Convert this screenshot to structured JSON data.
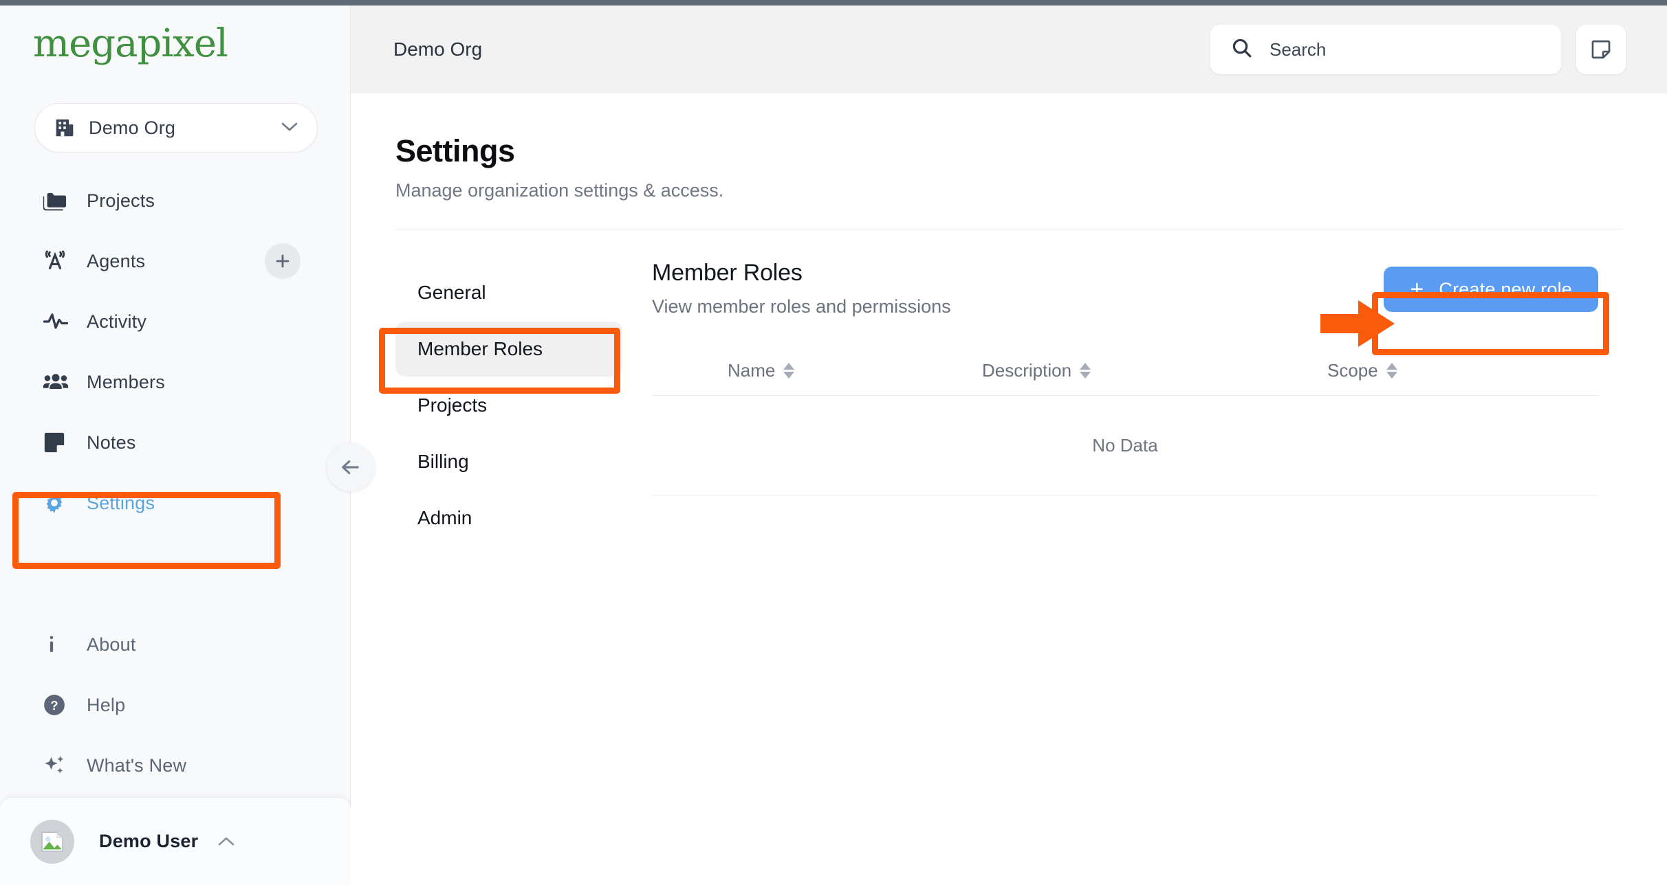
{
  "brand": {
    "logo_text": "megapixel",
    "logo_color": "#3f9140"
  },
  "sidebar": {
    "org_switcher": {
      "name": "Demo Org",
      "icon": "building-icon",
      "caret": "chevron-down-icon"
    },
    "items": [
      {
        "label": "Projects",
        "icon": "folder-icon",
        "active": false
      },
      {
        "label": "Agents",
        "icon": "broadcast-tower-icon",
        "active": false,
        "action": "add-agent-button"
      },
      {
        "label": "Activity",
        "icon": "pulse-icon",
        "active": false
      },
      {
        "label": "Members",
        "icon": "people-icon",
        "active": false
      },
      {
        "label": "Notes",
        "icon": "note-icon",
        "active": false
      },
      {
        "label": "Settings",
        "icon": "gear-icon",
        "active": true
      }
    ],
    "secondary_items": [
      {
        "label": "About",
        "icon": "info-icon"
      },
      {
        "label": "Help",
        "icon": "question-circle-icon"
      },
      {
        "label": "What's New",
        "icon": "sparkles-icon"
      }
    ],
    "user": {
      "name": "Demo User",
      "avatar": "broken-image-avatar",
      "caret": "chevron-up-icon"
    },
    "collapse": {
      "icon": "arrow-left-icon"
    },
    "active_color": "#59a5e0"
  },
  "topbar": {
    "title": "Demo Org",
    "search": {
      "placeholder": "Search",
      "icon": "search-icon"
    },
    "note_button": {
      "icon": "sticky-note-icon"
    }
  },
  "page": {
    "title": "Settings",
    "subtitle": "Manage organization settings & access."
  },
  "settings_tabs": [
    {
      "label": "General",
      "active": false
    },
    {
      "label": "Member Roles",
      "active": true
    },
    {
      "label": "Projects",
      "active": false
    },
    {
      "label": "Billing",
      "active": false
    },
    {
      "label": "Admin",
      "active": false
    }
  ],
  "panel": {
    "title": "Member Roles",
    "subtitle": "View member roles and permissions",
    "create_button": {
      "label": "Create new role",
      "icon": "plus-icon",
      "color": "#5b9cf3"
    },
    "table": {
      "columns": [
        {
          "label": "Name",
          "sortable": true
        },
        {
          "label": "Description",
          "sortable": true
        },
        {
          "label": "Scope",
          "sortable": true
        }
      ],
      "rows": [],
      "empty_text": "No Data"
    }
  },
  "annotations": {
    "color": "#fa5a09",
    "boxes": [
      {
        "target": "sidebar-item-settings"
      },
      {
        "target": "settings-tab-member-roles"
      },
      {
        "target": "create-new-role-button"
      }
    ],
    "arrow": {
      "target": "create-new-role-button",
      "direction": "right"
    }
  }
}
